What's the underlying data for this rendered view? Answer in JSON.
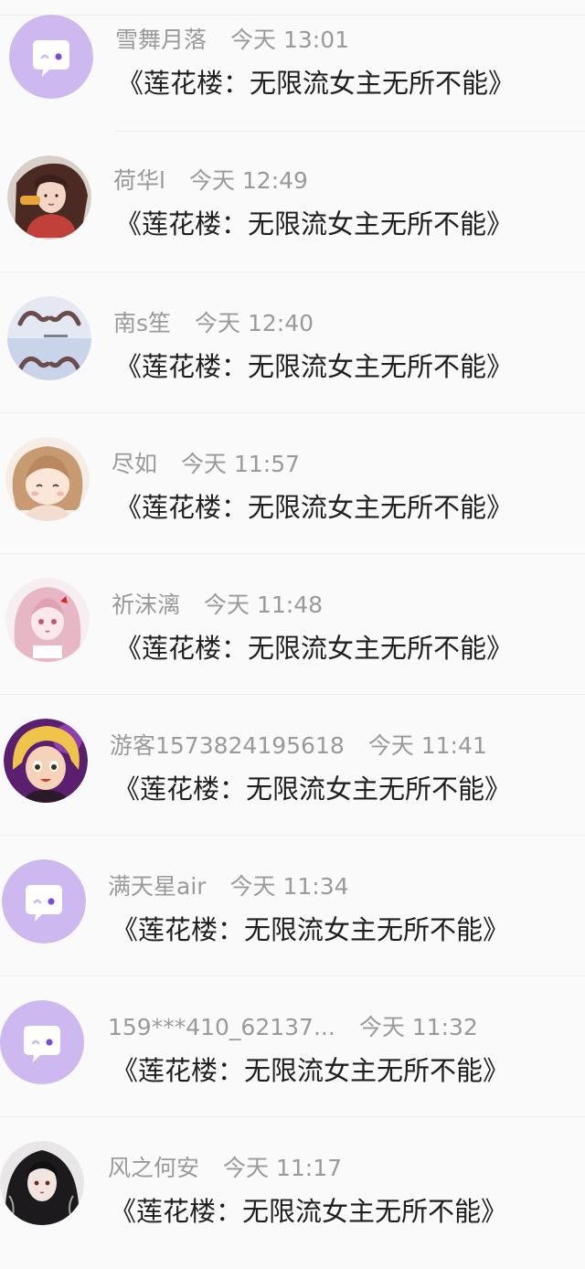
{
  "comments": [
    {
      "name": "雪舞月落",
      "time": "今天 13:01",
      "message": "《莲花楼：无限流女主无所不能》",
      "avatar": "default-avatar"
    },
    {
      "name": "荷华l",
      "time": "今天 12:49",
      "message": "《莲花楼：无限流女主无所不能》",
      "avatar": "anime-girl-red-avatar"
    },
    {
      "name": "南s笙",
      "time": "今天 12:40",
      "message": "《莲花楼：无限流女主无所不能》",
      "avatar": "hands-sky-avatar"
    },
    {
      "name": "尽如",
      "time": "今天 11:57",
      "message": "《莲花楼：无限流女主无所不能》",
      "avatar": "chibi-girl-avatar"
    },
    {
      "name": "祈沫漓",
      "time": "今天 11:48",
      "message": "《莲花楼：无限流女主无所不能》",
      "avatar": "pink-hair-girl-avatar"
    },
    {
      "name": "游客1573824195618",
      "time": "今天 11:41",
      "message": "《莲花楼：无限流女主无所不能》",
      "avatar": "blonde-doll-avatar"
    },
    {
      "name": "满天星air",
      "time": "今天 11:34",
      "message": "《莲花楼：无限流女主无所不能》",
      "avatar": "default-avatar"
    },
    {
      "name": "159***410_62137...",
      "time": "今天 11:32",
      "message": "《莲花楼：无限流女主无所不能》",
      "avatar": "default-avatar"
    },
    {
      "name": "风之何安",
      "time": "今天 11:17",
      "message": "《莲花楼：无限流女主无所不能》",
      "avatar": "dark-hair-girl-avatar"
    }
  ]
}
